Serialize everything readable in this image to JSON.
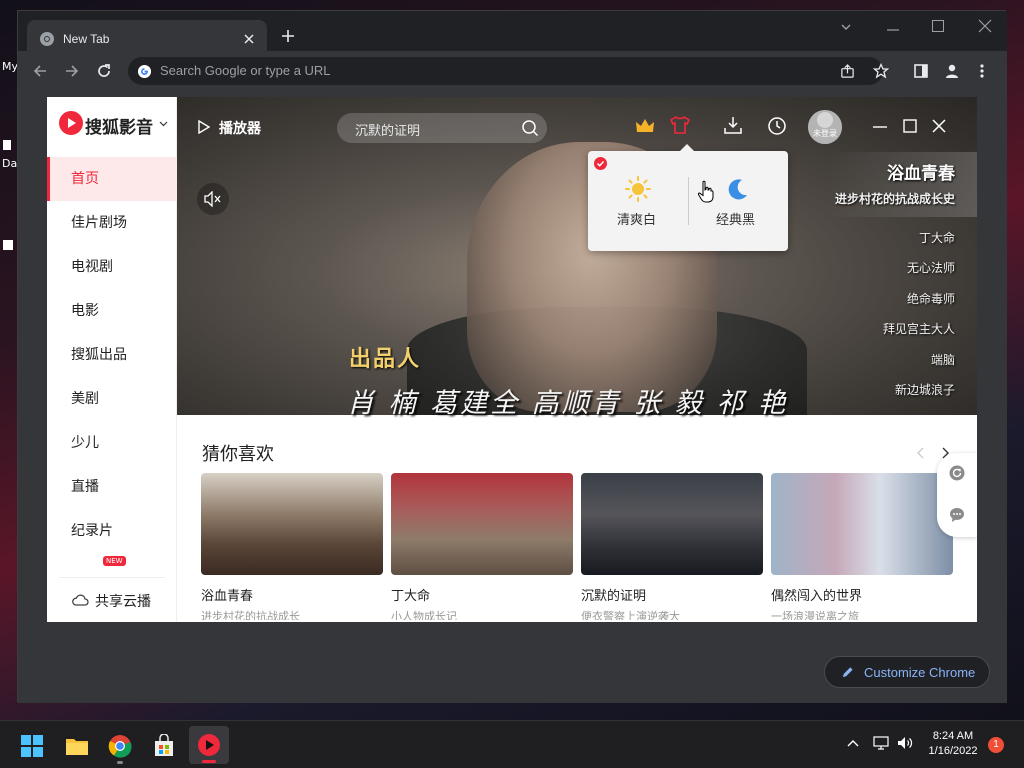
{
  "desktop": {
    "label_1": "My",
    "label_2": "Da"
  },
  "browser": {
    "tab_title": "New Tab",
    "omnibox_placeholder": "Search Google or type a URL",
    "customize_label": "Customize Chrome"
  },
  "app": {
    "brand": "搜狐影音",
    "player_label": "播放器",
    "search_placeholder": "沉默的证明",
    "login_label": "未登录",
    "sidebar": {
      "items": [
        {
          "label": "首页",
          "active": true
        },
        {
          "label": "佳片剧场"
        },
        {
          "label": "电视剧"
        },
        {
          "label": "电影"
        },
        {
          "label": "搜狐出品"
        },
        {
          "label": "美剧"
        },
        {
          "label": "少儿"
        },
        {
          "label": "直播"
        },
        {
          "label": "纪录片"
        }
      ],
      "new_badge": "NEW",
      "cloud_label": "共享云播"
    },
    "hero": {
      "credit_label": "出品人",
      "credit_names": "肖 楠   葛建全   高顺青   张 毅   祁 艳",
      "featured_title": "浴血青春",
      "featured_subtitle": "进步村花的抗战成长史",
      "side_list": [
        "丁大命",
        "无心法师",
        "绝命毒师",
        "拜见宫主大人",
        "端脑",
        "新边城浪子"
      ]
    },
    "theme_popup": {
      "light_label": "清爽白",
      "dark_label": "经典黑"
    },
    "section": {
      "title": "猜你喜欢",
      "cards": [
        {
          "title": "浴血青春",
          "subtitle": "进步村花的抗战成长"
        },
        {
          "title": "丁大命",
          "subtitle": "小人物成长记"
        },
        {
          "title": "沉默的证明",
          "subtitle": "便衣警察上演逆袭大"
        },
        {
          "title": "偶然闯入的世界",
          "subtitle": "一场浪漫说离之旅"
        }
      ]
    }
  },
  "taskbar": {
    "time": "8:24 AM",
    "date": "1/16/2022",
    "notification_count": "1"
  },
  "colors": {
    "accent": "#f0283c",
    "chrome_dark": "#202124",
    "chrome_toolbar": "#35363a",
    "link_blue": "#8ab4f8",
    "credit_gold": "#f2d16b"
  }
}
